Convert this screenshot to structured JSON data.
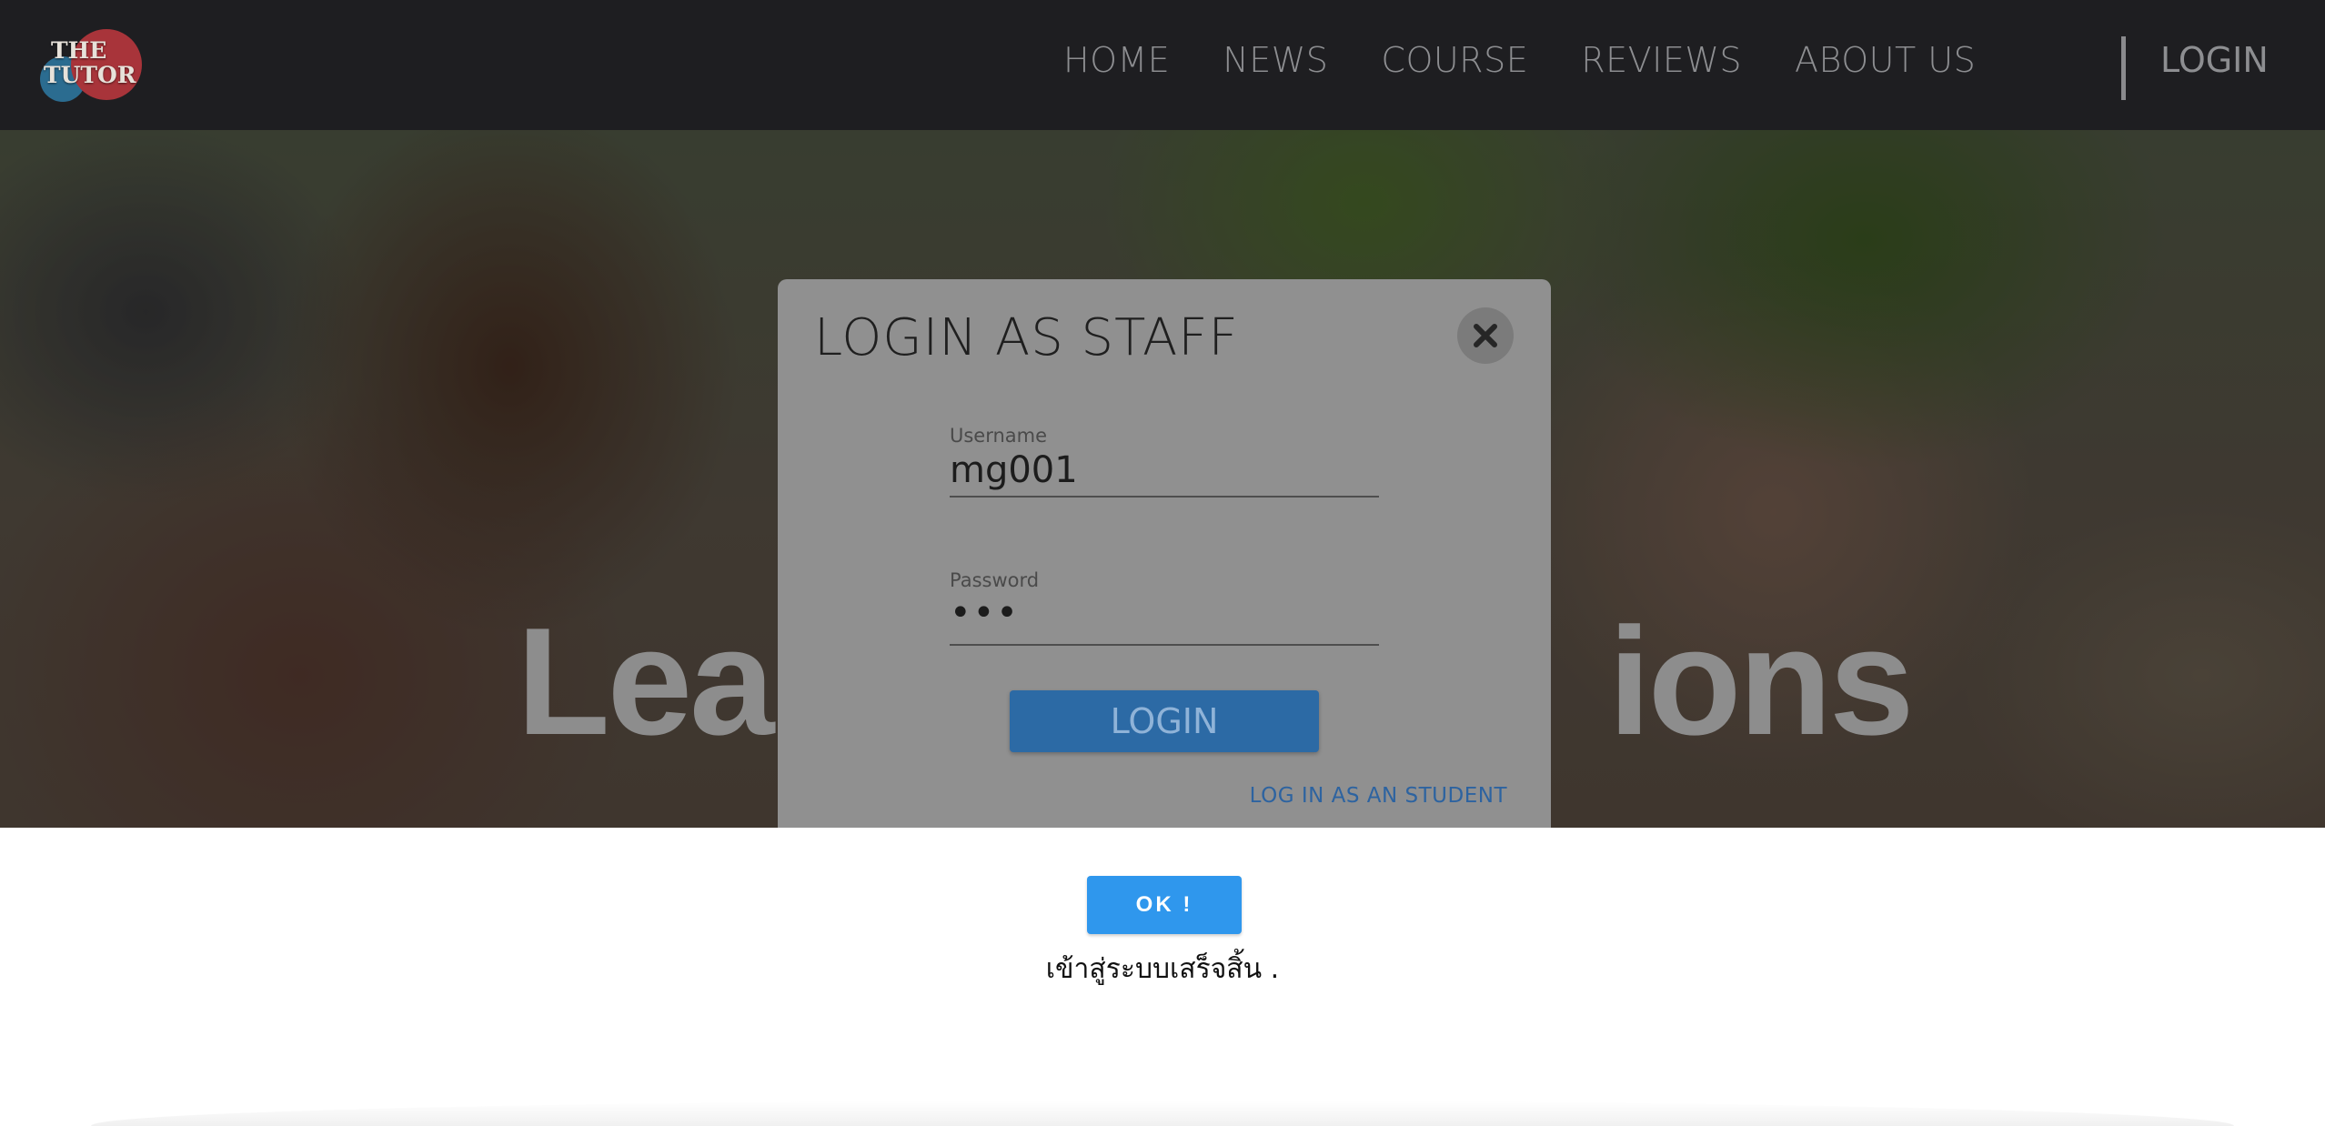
{
  "brand": {
    "logo_line1": "THE",
    "logo_line2": "TUTOR"
  },
  "nav": {
    "items": [
      {
        "label": "HOME"
      },
      {
        "label": "NEWS"
      },
      {
        "label": "COURSE"
      },
      {
        "label": "REVIEWS"
      },
      {
        "label": "ABOUT US"
      }
    ],
    "login_label": "LOGIN"
  },
  "hero": {
    "title": "Lead",
    "title_end": "ions"
  },
  "modal": {
    "title": "LOGIN AS STAFF",
    "close_icon": "close-icon",
    "username": {
      "label": "Username",
      "value": "mg001"
    },
    "password": {
      "label": "Password",
      "value": "•••"
    },
    "login_button": "LOGIN",
    "alt_link": "LOG IN AS AN STUDENT"
  },
  "alert": {
    "ok_button": "OK !",
    "message": "เข้าสู่ระบบเสร็จสิ้น ."
  },
  "colors": {
    "navbar": "#1e1e21",
    "modal_bg": "#909090",
    "login_button": "#2c6aa5",
    "ok_button": "#2f97ed"
  }
}
